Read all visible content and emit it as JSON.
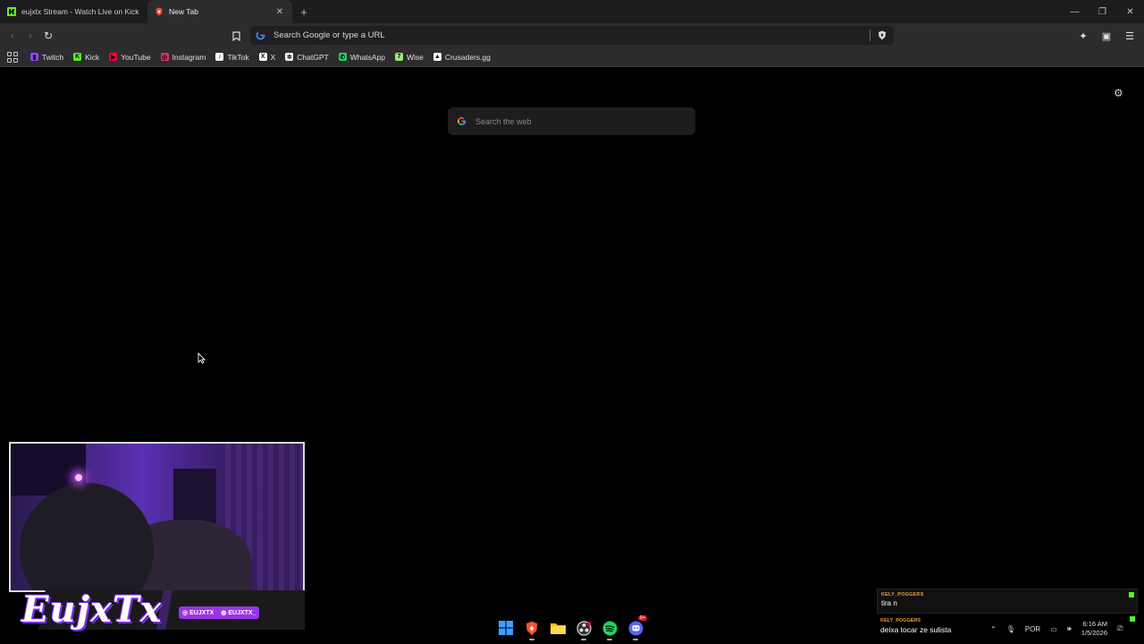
{
  "tabs": [
    {
      "title": "eujxtx Stream - Watch Live on Kick",
      "favicon": "kick-icon",
      "active": false
    },
    {
      "title": "New Tab",
      "favicon": "brave-icon",
      "active": true
    }
  ],
  "toolbar": {
    "omnibox_text": "Search Google or type a URL"
  },
  "bookmarks": [
    {
      "label": "Twitch",
      "icon": "twitch-icon",
      "color": "#9146ff"
    },
    {
      "label": "Kick",
      "icon": "kick-icon",
      "color": "#53fc18"
    },
    {
      "label": "YouTube",
      "icon": "youtube-icon",
      "color": "#ff0033"
    },
    {
      "label": "Instagram",
      "icon": "instagram-icon",
      "color": "#e1306c"
    },
    {
      "label": "TikTok",
      "icon": "tiktok-icon",
      "color": "#ffffff"
    },
    {
      "label": "X",
      "icon": "x-icon",
      "color": "#ffffff"
    },
    {
      "label": "ChatGPT",
      "icon": "chatgpt-icon",
      "color": "#ffffff"
    },
    {
      "label": "WhatsApp",
      "icon": "whatsapp-icon",
      "color": "#25d366"
    },
    {
      "label": "Wise",
      "icon": "wise-icon",
      "color": "#9fe870"
    },
    {
      "label": "Crusaders.gg",
      "icon": "crusaders-icon",
      "color": "#ffffff"
    }
  ],
  "newtab": {
    "search_placeholder": "Search the web"
  },
  "overlay": {
    "brand_name": "EujxTx",
    "socials": [
      "EUJXTX",
      "EUJXTX_"
    ],
    "chat": [
      {
        "user": "KELY_POGGERS",
        "message": "tira n"
      },
      {
        "user": "KELY_POGGERS",
        "message": "deixa tocar ze sulista"
      }
    ]
  },
  "taskbar": {
    "apps": [
      "windows-start-icon",
      "brave-icon",
      "file-explorer-icon",
      "obs-icon",
      "spotify-icon",
      "discord-icon"
    ],
    "discord_badge": "9+",
    "language": "POR",
    "time": "6:16 AM",
    "date": "1/5/2026"
  }
}
